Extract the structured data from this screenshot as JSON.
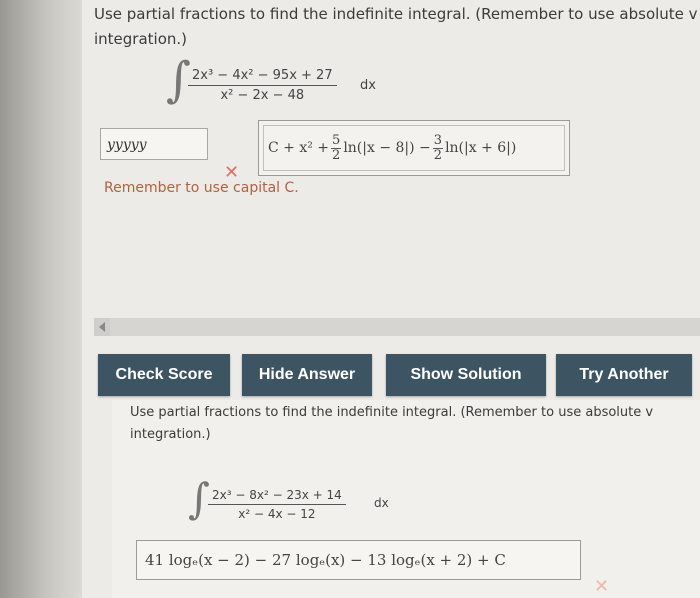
{
  "question1": {
    "prompt_line1": "Use partial fractions to find the indefinite integral. (Remember to use absolute v",
    "prompt_line2": "integration.)",
    "integral_symbol": "∫",
    "numerator": "2x³ − 4x² − 95x + 27",
    "denominator": "x² − 2x − 48",
    "dx": "dx",
    "user_answer": "yyyyy",
    "wrong_mark": "✕",
    "correct_answer": {
      "prefix": "C + x² +",
      "frac1_top": "5",
      "frac1_bottom": "2",
      "middle": "ln(|x − 8|) −",
      "frac2_top": "3",
      "frac2_bottom": "2",
      "suffix": "ln(|x + 6|)"
    },
    "feedback": "Remember to use capital C."
  },
  "buttons": {
    "check_score": "Check Score",
    "hide_answer": "Hide Answer",
    "show_solution": "Show Solution",
    "try_another": "Try Another"
  },
  "question2": {
    "prompt_line1": "Use partial fractions to find the indefinite integral. (Remember to use absolute v",
    "prompt_line2": "integration.)",
    "integral_symbol": "∫",
    "numerator": "2x³ − 8x² − 23x + 14",
    "denominator": "x² − 4x − 12",
    "dx": "dx",
    "answer": "41 logₑ(x − 2) − 27 logₑ(x) − 13 logₑ(x + 2) + C",
    "mark": "✕"
  },
  "colors": {
    "button_bg": "#3d5562",
    "feedback": "#b3613f",
    "wrong_mark": "#e07060"
  },
  "icons": {
    "scroll_left": "chevron-left-icon",
    "wrong": "close-icon"
  }
}
